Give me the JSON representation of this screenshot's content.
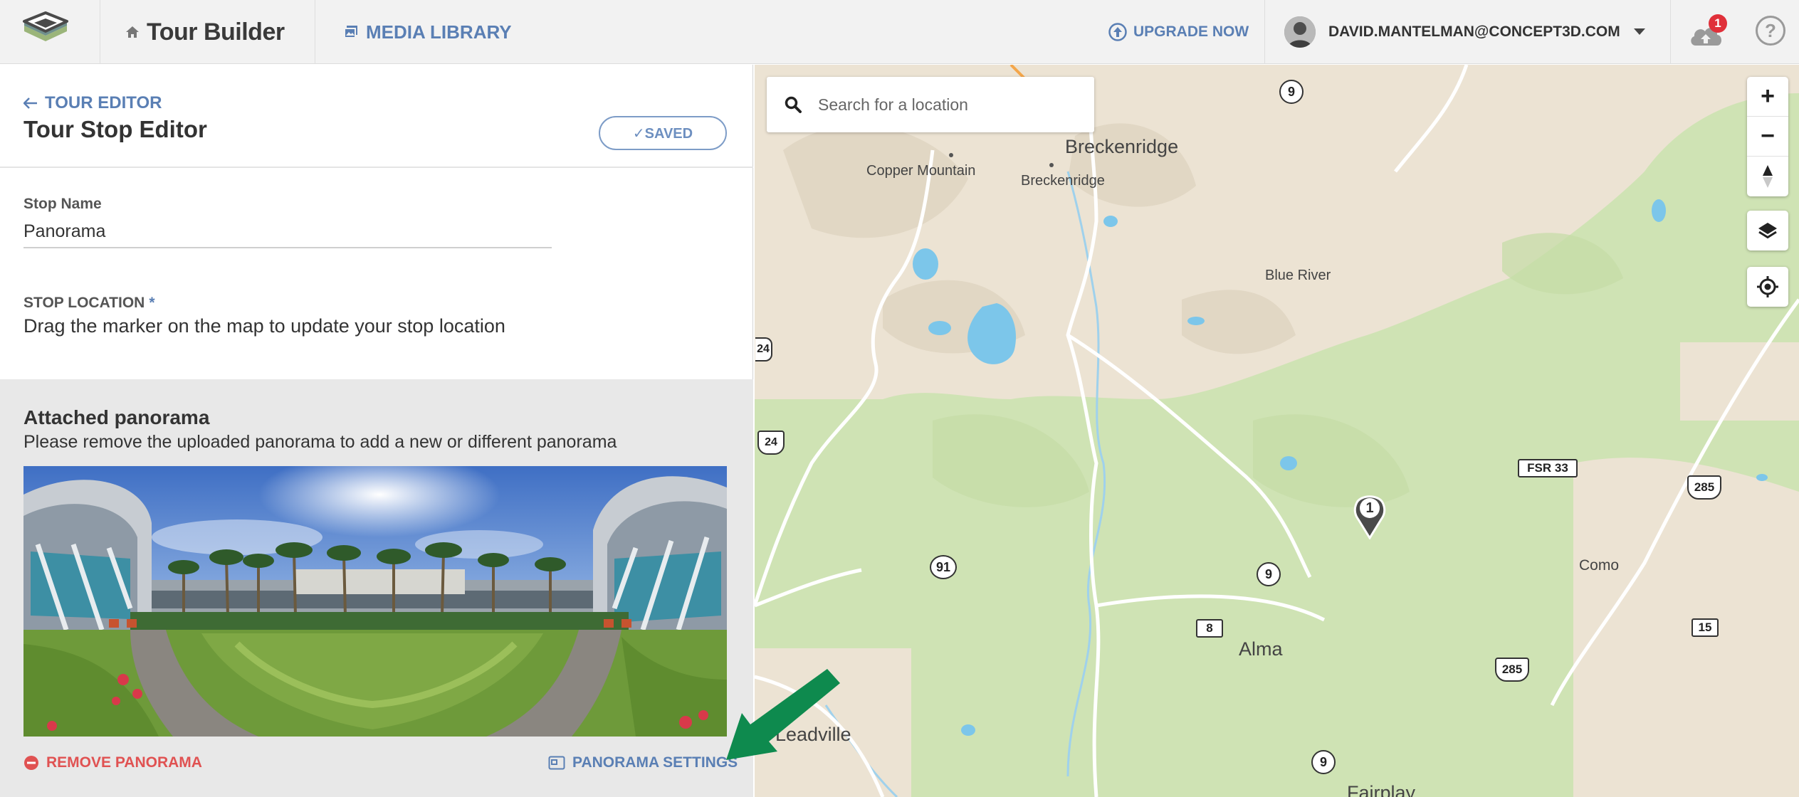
{
  "topbar": {
    "app_name": "Tour Builder",
    "media_library": "MEDIA LIBRARY",
    "upgrade": "UPGRADE NOW",
    "user_email": "DAVID.MANTELMAN@CONCEPT3D.COM",
    "notification_count": "1",
    "help": "?"
  },
  "editor": {
    "back_label": "TOUR EDITOR",
    "title": "Tour Stop Editor",
    "saved_label": "✓SAVED",
    "stop_name_label": "Stop Name",
    "stop_name_value": "Panorama",
    "stop_location_label": "STOP LOCATION",
    "required_mark": "*",
    "stop_location_help": "Drag the marker on the map to update your stop location"
  },
  "panorama": {
    "title": "Attached panorama",
    "help": "Please remove the uploaded panorama to add a new or different panorama",
    "remove_label": "REMOVE PANORAMA",
    "settings_label": "PANORAMA SETTINGS"
  },
  "map": {
    "search_placeholder": "Search for a location",
    "zoom_in": "+",
    "zoom_out": "−",
    "marker_number": "1",
    "places": {
      "breckenridge_big": "Breckenridge",
      "breckenridge_small": "Breckenridge",
      "copper_mountain": "Copper Mountain",
      "blue_river": "Blue River",
      "alma": "Alma",
      "como": "Como",
      "leadville": "Leadville",
      "fairplay": "Fairplay"
    },
    "roads": {
      "r9_top": "9",
      "r9_mid": "9",
      "r9_bottom": "9",
      "r91": "91",
      "r24_top": "24",
      "r24_mid": "24",
      "r8": "8",
      "fsr33": "FSR 33",
      "r285_a": "285",
      "r285_b": "285",
      "r15": "15"
    }
  },
  "colors": {
    "accent": "#5a7fb4",
    "danger": "#e05252",
    "arrow": "#0e8a4e",
    "forest": "#cfe3b4",
    "terrain": "#ece3d3",
    "water": "#7cc6ea"
  }
}
